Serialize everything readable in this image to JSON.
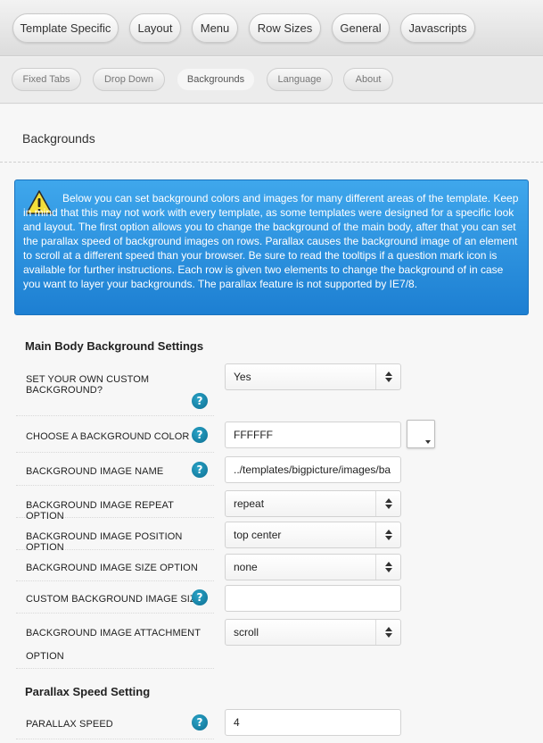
{
  "top_tabs": [
    {
      "label": "Template Specific"
    },
    {
      "label": "Layout"
    },
    {
      "label": "Menu"
    },
    {
      "label": "Row Sizes"
    },
    {
      "label": "General"
    },
    {
      "label": "Javascripts"
    }
  ],
  "sub_tabs": [
    {
      "label": "Fixed Tabs",
      "active": false
    },
    {
      "label": "Drop Down",
      "active": false
    },
    {
      "label": "Backgrounds",
      "active": true
    },
    {
      "label": "Language",
      "active": false
    },
    {
      "label": "About",
      "active": false
    }
  ],
  "page_title": "Backgrounds",
  "info": {
    "icon": "warning-icon",
    "text": "Below you can set background colors and images for many different areas of the template. Keep in mind that this may not work with every template, as some templates were designed for a specific look and layout. The first option allows you to change the background of the main body, after that you can set the parallax speed of background images on rows. Parallax causes the background image of an element to scroll at a different speed than your browser. Be sure to read the tooltips if a question mark icon is available for further instructions. Each row is given two elements to change the background of in case you want to layer your backgrounds. The parallax feature is not supported by IE7/8."
  },
  "sections": {
    "main_body": "Main Body Background Settings",
    "parallax": "Parallax Speed Setting"
  },
  "help_glyph": "?",
  "fields": {
    "custom_bg": {
      "label": "SET YOUR OWN CUSTOM BACKGROUND?",
      "value": "Yes"
    },
    "bg_color": {
      "label": "CHOOSE A BACKGROUND COLOR",
      "value": "FFFFFF",
      "swatch": "#FFFFFF"
    },
    "bg_image": {
      "label": "BACKGROUND IMAGE NAME",
      "value": "../templates/bigpicture/images/ba"
    },
    "repeat": {
      "label": "BACKGROUND IMAGE REPEAT OPTION",
      "value": "repeat"
    },
    "position": {
      "label": "BACKGROUND IMAGE POSITION OPTION",
      "value": "top center"
    },
    "size": {
      "label": "BACKGROUND IMAGE SIZE OPTION",
      "value": "none"
    },
    "custom_size": {
      "label": "CUSTOM BACKGROUND IMAGE SIZE",
      "value": ""
    },
    "attachment": {
      "label_line1": "BACKGROUND IMAGE ATTACHMENT",
      "label_line2": "OPTION",
      "value": "scroll"
    },
    "parallax_speed": {
      "label": "PARALLAX SPEED",
      "value": "4"
    }
  },
  "colors": {
    "info_bg": "#2b8fdd",
    "help": "#1a87ad"
  }
}
